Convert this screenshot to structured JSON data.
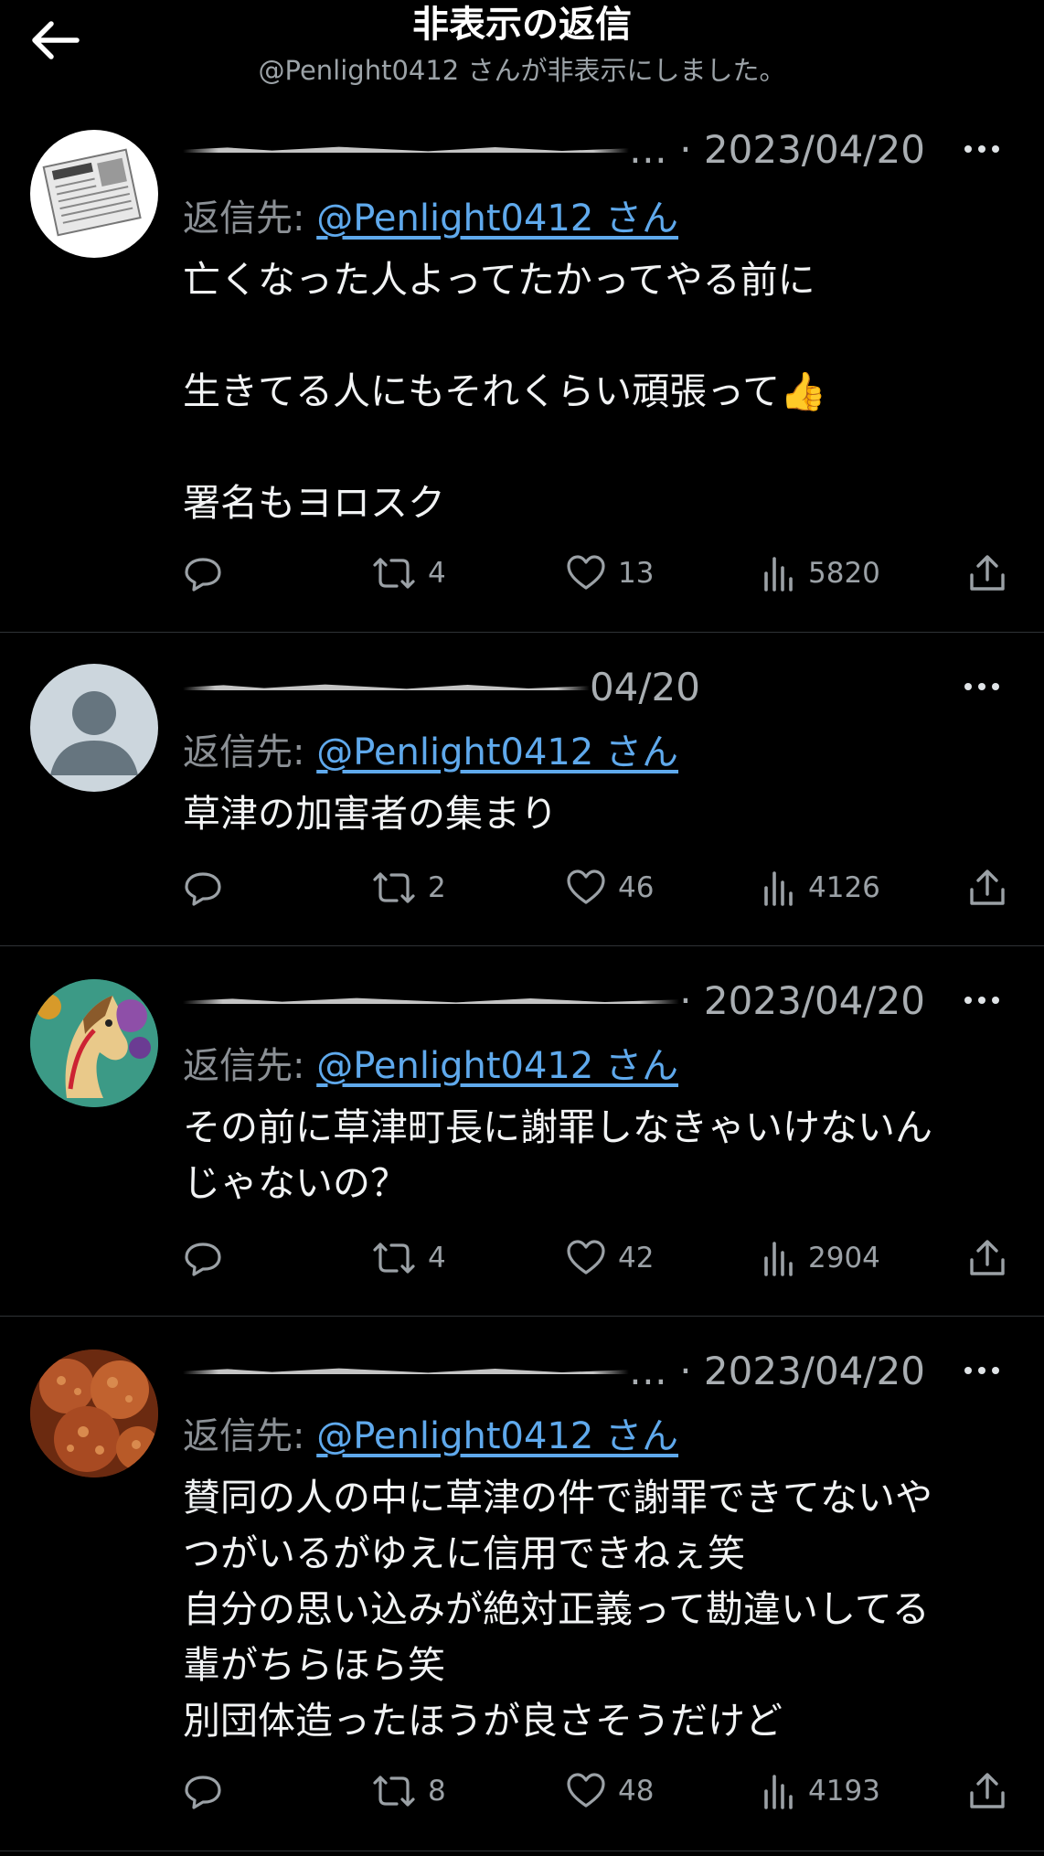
{
  "header": {
    "title": "非表示の返信",
    "subtitle": "@Penlight0412 さんが非表示にしました。"
  },
  "tweets": [
    {
      "date": "… · 2023/04/20",
      "reply_prefix": "返信先: ",
      "reply_handle": "@Penlight0412 さん",
      "text": "亡くなった人よってたかってやる前に\n\n生きてる人にもそれくらい頑張って👍\n\n署名もヨロスク",
      "retweets": "4",
      "likes": "13",
      "views": "5820",
      "avatar_icon": "newspaper-avatar"
    },
    {
      "date": "04/20",
      "reply_prefix": "返信先: ",
      "reply_handle": "@Penlight0412 さん",
      "text": "草津の加害者の集まり",
      "retweets": "2",
      "likes": "46",
      "views": "4126",
      "avatar_icon": "default-person-avatar"
    },
    {
      "date": "· 2023/04/20",
      "reply_prefix": "返信先: ",
      "reply_handle": "@Penlight0412 さん",
      "text": "その前に草津町長に謝罪しなきゃいけないん\nじゃないの？",
      "retweets": "4",
      "likes": "42",
      "views": "2904",
      "avatar_icon": "horse-avatar"
    },
    {
      "date": "… · 2023/04/20",
      "reply_prefix": "返信先: ",
      "reply_handle": "@Penlight0412 さん",
      "text": "賛同の人の中に草津の件で謝罪できてないや\nつがいるがゆえに信用できねぇ笑\n自分の思い込みが絶対正義って勘違いしてる\n輩がちらほら笑\n別団体造ったほうが良さそうだけど",
      "retweets": "8",
      "likes": "48",
      "views": "4193",
      "avatar_icon": "fried-chicken-avatar"
    }
  ],
  "colors": {
    "background": "#000000",
    "link": "#5fa9ec",
    "muted": "#9ba1a6",
    "divider": "#2f3336"
  }
}
